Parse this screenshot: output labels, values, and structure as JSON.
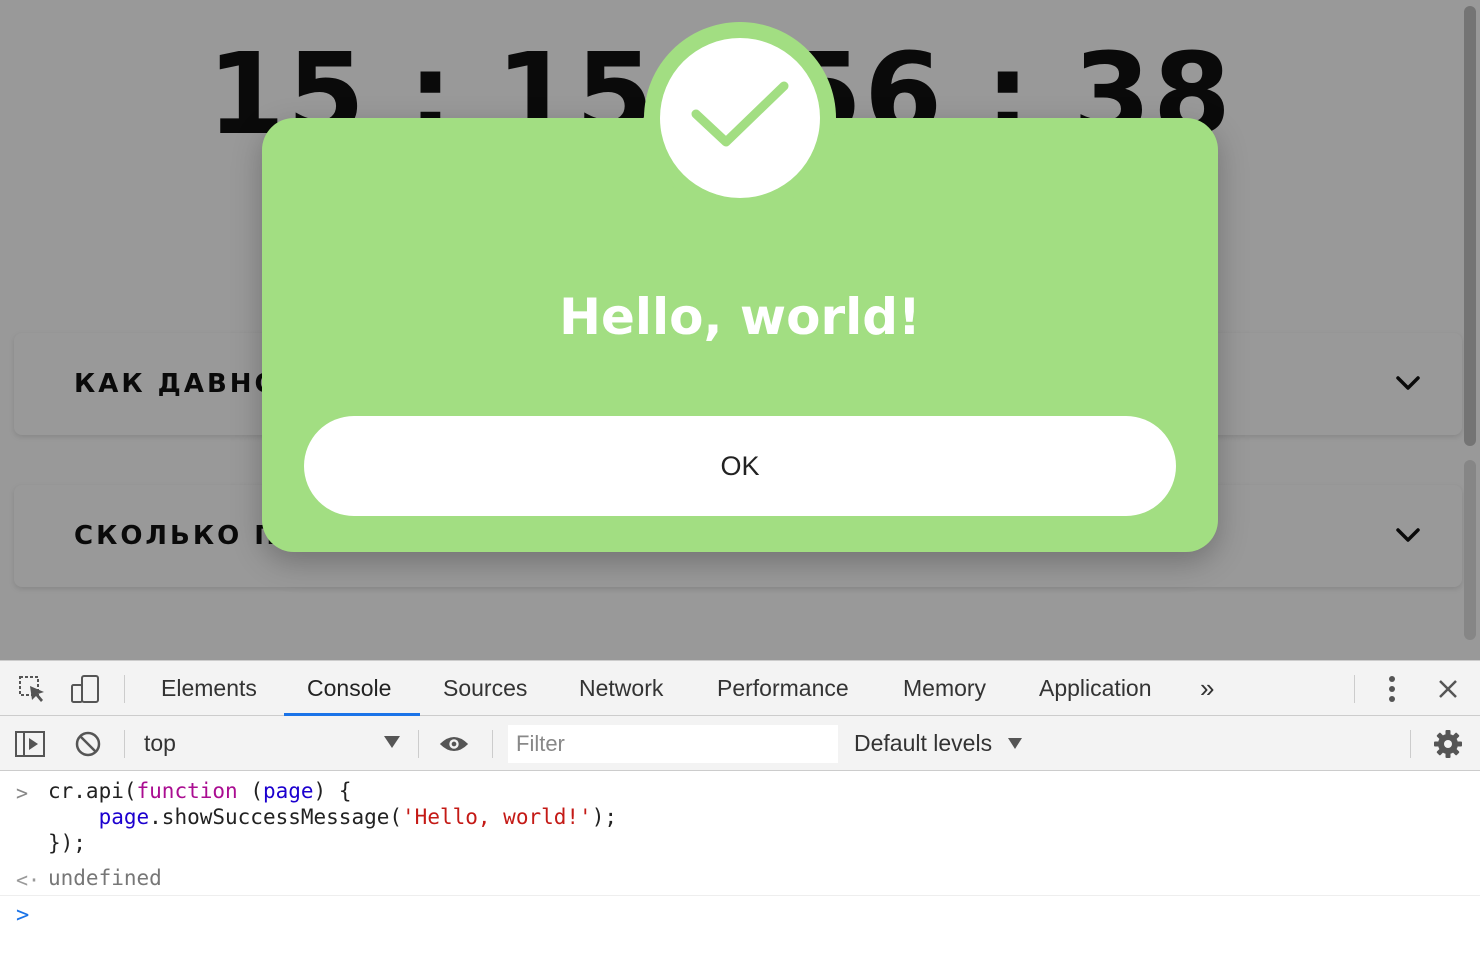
{
  "page": {
    "timer": "15 : 15 : 56 : 38",
    "accordion": [
      {
        "title": "КАК ДАВНО"
      },
      {
        "title": "СКОЛЬКО П"
      }
    ]
  },
  "modal": {
    "title": "Hello, world!",
    "ok_label": "OK",
    "accent_color": "#a2de82",
    "icon": "check-icon"
  },
  "devtools": {
    "tabs": [
      "Elements",
      "Console",
      "Sources",
      "Network",
      "Performance",
      "Memory",
      "Application"
    ],
    "active_tab": "Console",
    "more_tabs": "»",
    "context": "top",
    "filter_placeholder": "Filter",
    "levels": "Default levels",
    "console": {
      "input_line1_a": "cr.api(",
      "input_line1_kw": "function",
      "input_line1_b": " (",
      "input_line1_var": "page",
      "input_line1_c": ") {",
      "input_line2_var": "page",
      "input_line2_a": ".showSuccessMessage(",
      "input_line2_str": "'Hello, world!'",
      "input_line2_b": ");",
      "input_line3": "});",
      "result": "undefined"
    }
  }
}
